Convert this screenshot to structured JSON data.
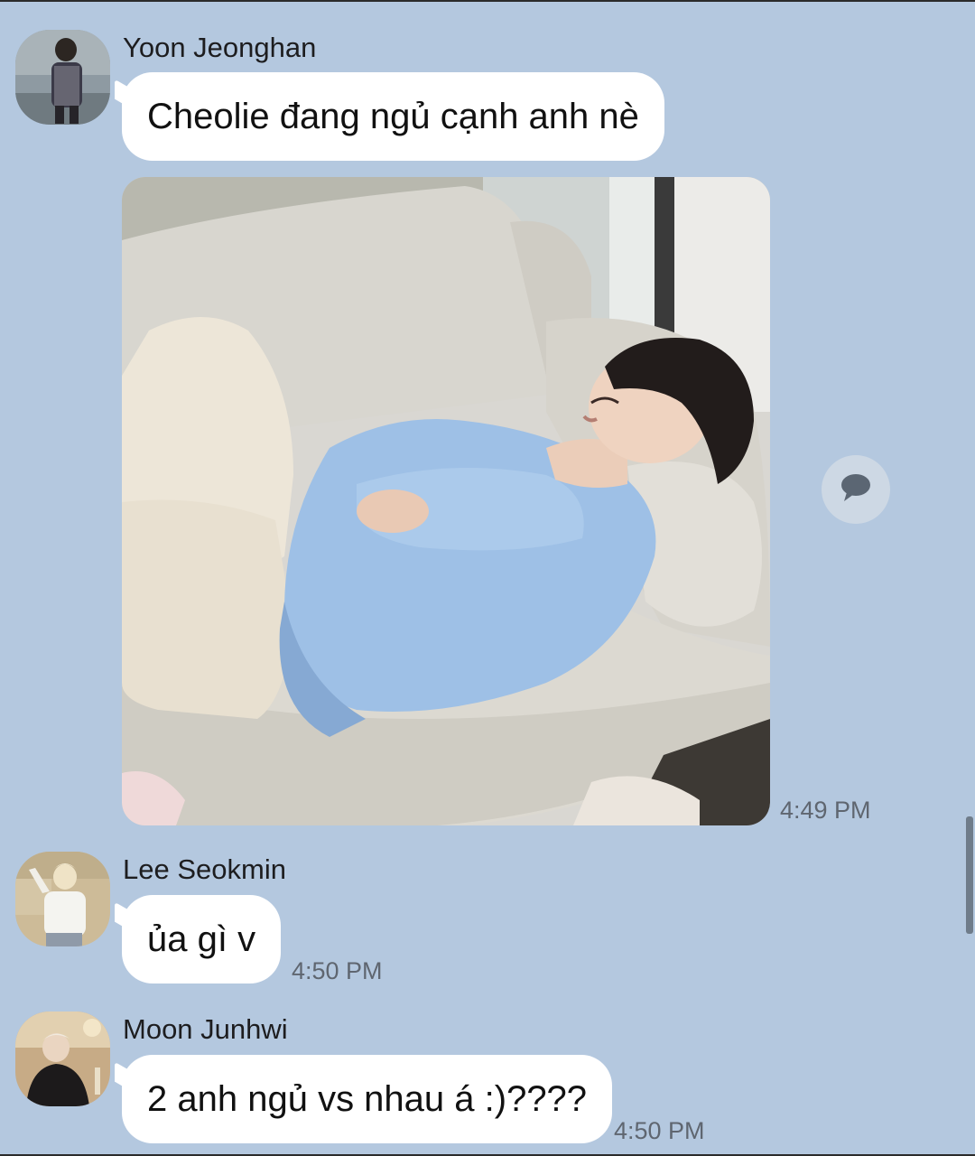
{
  "messages": [
    {
      "sender": "Yoon Jeonghan",
      "text": "Cheolie đang ngủ cạnh anh nè"
    },
    {
      "sender": "Yoon Jeonghan",
      "image": "photo of a person sleeping on a sofa",
      "time": "4:49 PM"
    },
    {
      "sender": "Lee Seokmin",
      "text": "ủa gì v",
      "time": "4:50 PM"
    },
    {
      "sender": "Moon Junhwi",
      "text": "2 anh ngủ vs nhau á :)????",
      "time": "4:50 PM"
    }
  ],
  "icons": {
    "share": "speech-bubble-icon"
  },
  "colors": {
    "background": "#b4c8df",
    "bubble": "#ffffff",
    "time": "#5f6670"
  }
}
